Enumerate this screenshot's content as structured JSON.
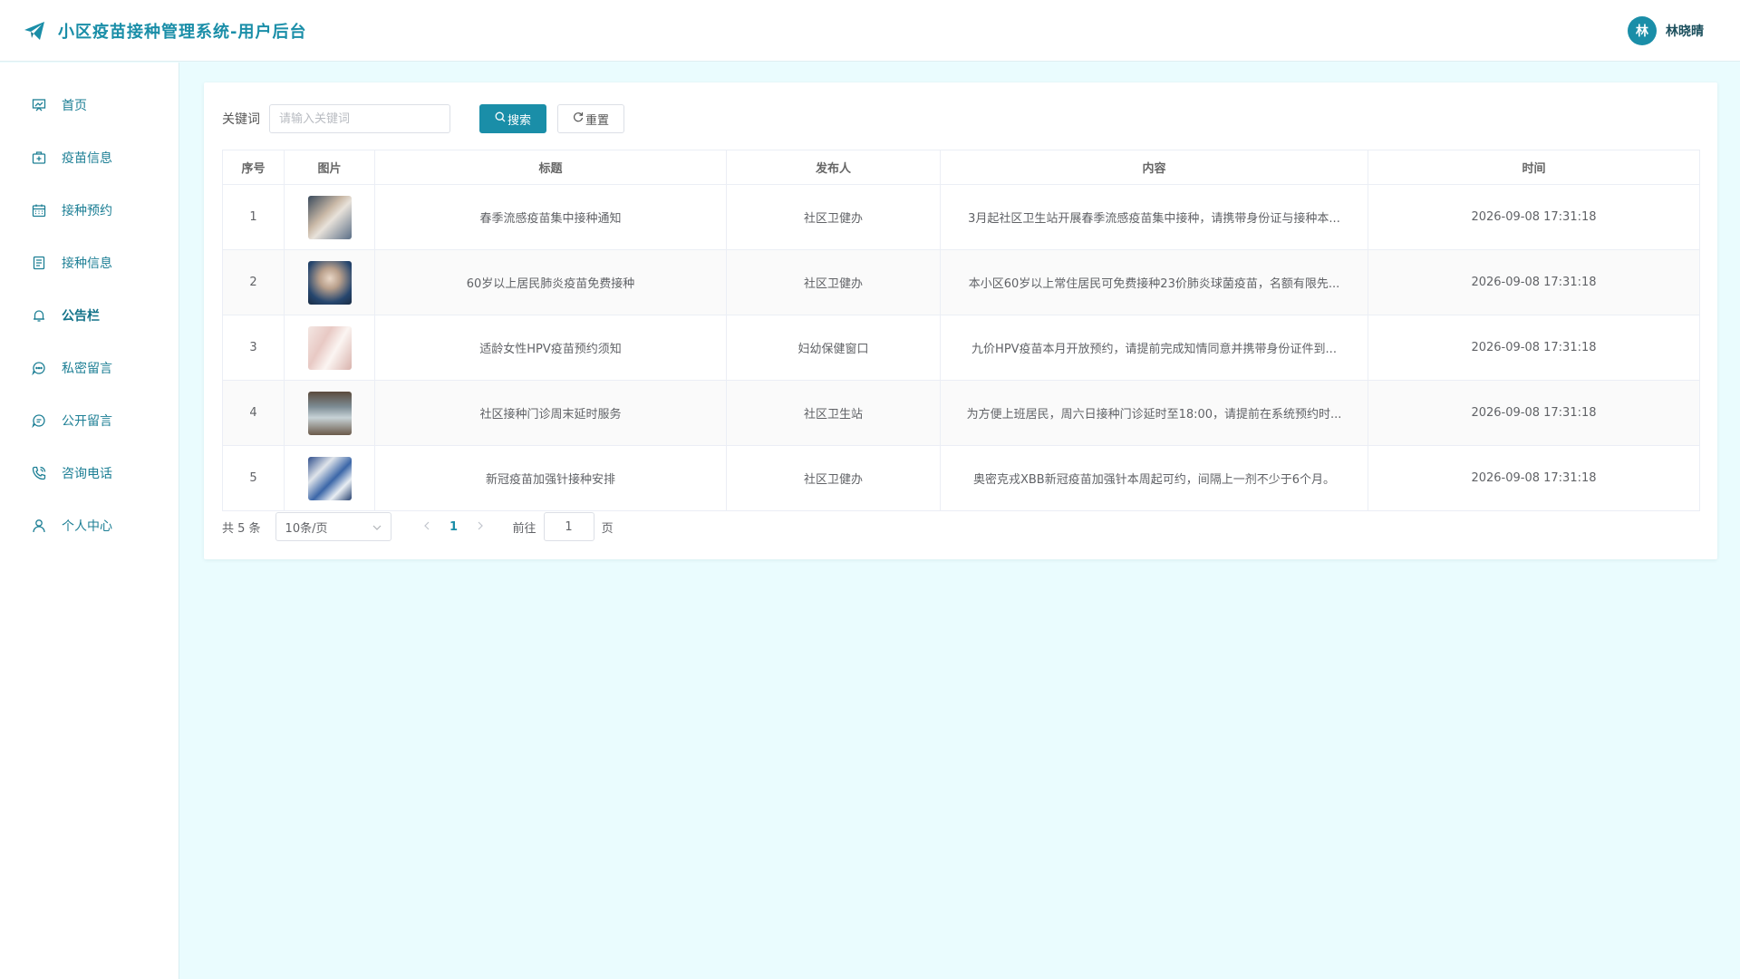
{
  "header": {
    "app_title": "小区疫苗接种管理系统-用户后台",
    "avatar_text": "林",
    "user_name": "林晓晴",
    "accent_color": "#1a8ea8"
  },
  "sidebar": {
    "items": [
      {
        "label": "首页",
        "icon": "dashboard-icon"
      },
      {
        "label": "疫苗信息",
        "icon": "medkit-icon"
      },
      {
        "label": "接种预约",
        "icon": "calendar-icon"
      },
      {
        "label": "接种信息",
        "icon": "document-icon"
      },
      {
        "label": "公告栏",
        "icon": "bell-icon",
        "active": true
      },
      {
        "label": "私密留言",
        "icon": "chat-icon"
      },
      {
        "label": "公开留言",
        "icon": "comment-icon"
      },
      {
        "label": "咨询电话",
        "icon": "phone-icon"
      },
      {
        "label": "个人中心",
        "icon": "user-icon"
      }
    ]
  },
  "search": {
    "label": "关键词",
    "placeholder": "请输入关键词",
    "value": "",
    "search_button": "搜索",
    "reset_button": "重置"
  },
  "table": {
    "headers": [
      "序号",
      "图片",
      "标题",
      "发布人",
      "内容",
      "时间"
    ],
    "rows": [
      {
        "index": "1",
        "title": "春季流感疫苗集中接种通知",
        "publisher": "社区卫健办",
        "content": "3月起社区卫生站开展春季流感疫苗集中接种，请携带身份证与接种本...",
        "time": "2026-09-08 17:31:18"
      },
      {
        "index": "2",
        "title": "60岁以上居民肺炎疫苗免费接种",
        "publisher": "社区卫健办",
        "content": "本小区60岁以上常住居民可免费接种23价肺炎球菌疫苗，名额有限先...",
        "time": "2026-09-08 17:31:18"
      },
      {
        "index": "3",
        "title": "适龄女性HPV疫苗预约须知",
        "publisher": "妇幼保健窗口",
        "content": "九价HPV疫苗本月开放预约，请提前完成知情同意并携带身份证件到...",
        "time": "2026-09-08 17:31:18"
      },
      {
        "index": "4",
        "title": "社区接种门诊周末延时服务",
        "publisher": "社区卫生站",
        "content": "为方便上班居民，周六日接种门诊延时至18:00，请提前在系统预约时...",
        "time": "2026-09-08 17:31:18"
      },
      {
        "index": "5",
        "title": "新冠疫苗加强针接种安排",
        "publisher": "社区卫健办",
        "content": "奥密克戎XBB新冠疫苗加强针本周起可约，间隔上一剂不少于6个月。",
        "time": "2026-09-08 17:31:18"
      }
    ]
  },
  "pagination": {
    "total_text": "共 5 条",
    "page_size": "10条/页",
    "current_page": "1",
    "goto_label": "前往",
    "goto_value": "1",
    "page_unit": "页"
  }
}
